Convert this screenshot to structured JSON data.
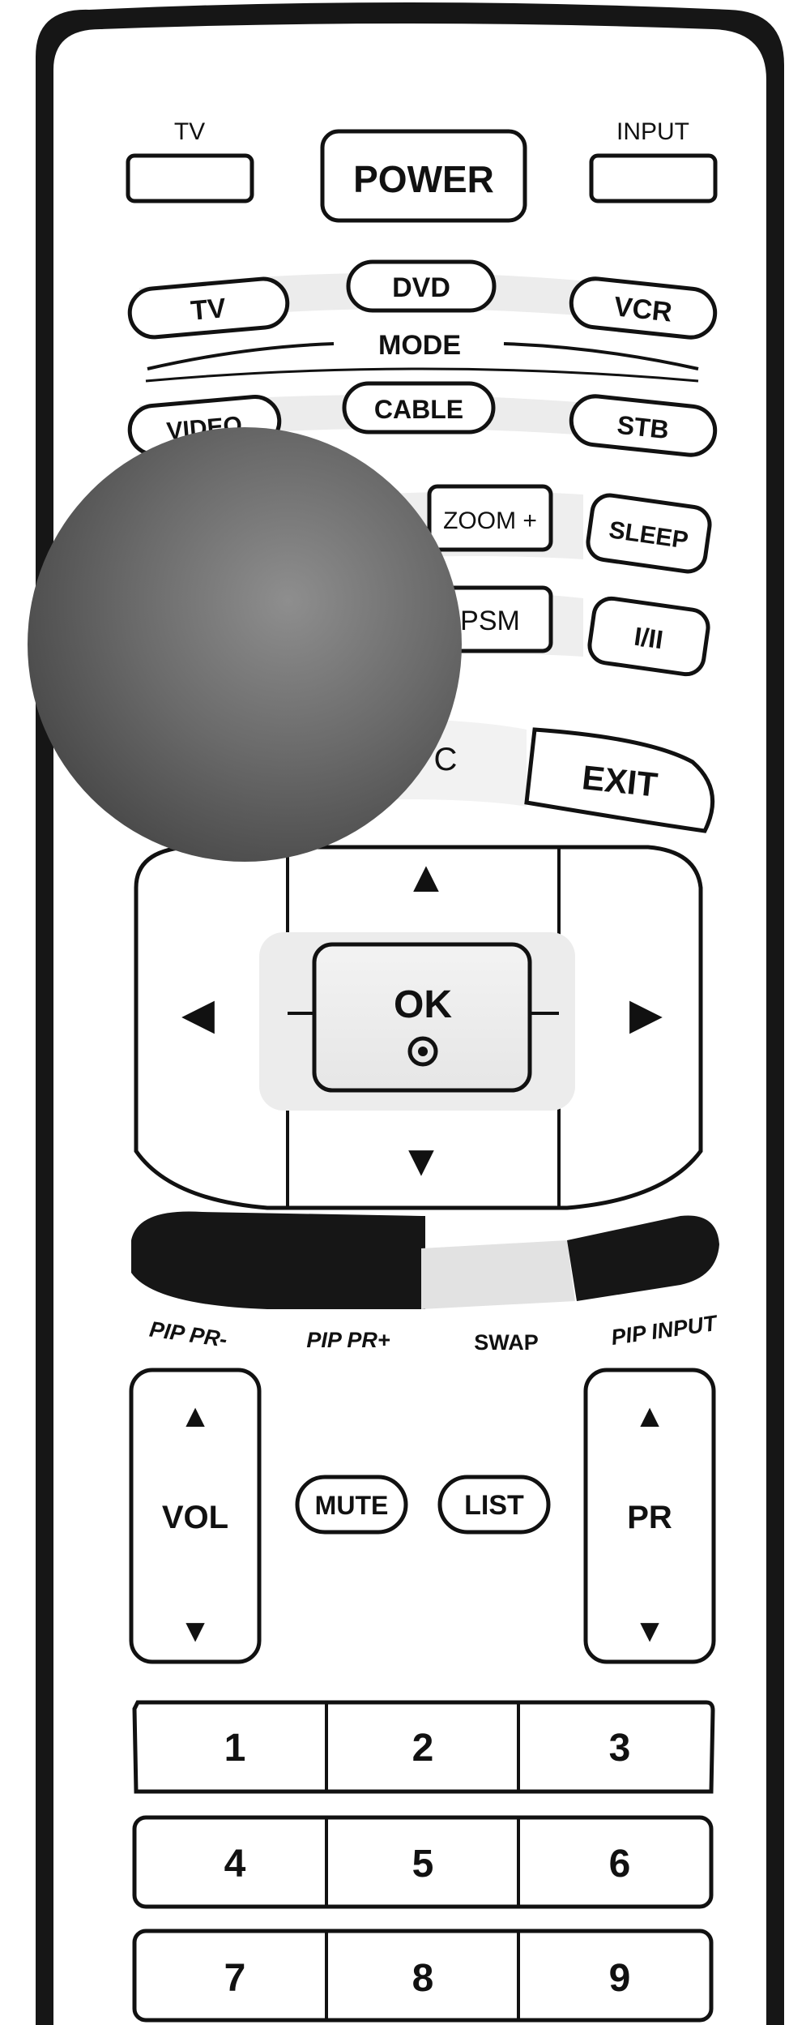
{
  "top": {
    "tv": "TV",
    "power": "POWER",
    "input": "INPUT"
  },
  "mode": {
    "label": "MODE",
    "row1": [
      "TV",
      "DVD",
      "VCR"
    ],
    "row2": [
      "VIDEO",
      "CABLE",
      "STB"
    ]
  },
  "row_zoom": {
    "zoom_plus": "ZOOM +",
    "sleep": "SLEEP"
  },
  "row_psm": {
    "psm": "PSM",
    "i_ii": "I/II"
  },
  "row_exit": {
    "partial": "C",
    "exit": "EXIT"
  },
  "nav": {
    "ok": "OK",
    "up": "▲",
    "down": "▼",
    "left": "◀",
    "right": "▶"
  },
  "pip": {
    "pr_minus": "PIP PR-",
    "pr_plus": "PIP PR+",
    "swap": "SWAP",
    "input": "PIP INPUT"
  },
  "volume": {
    "label": "VOL",
    "up": "▲",
    "down": "▼"
  },
  "program": {
    "label": "PR",
    "up": "▲",
    "down": "▼"
  },
  "mute": "MUTE",
  "list": "LIST",
  "keypad": [
    "1",
    "2",
    "3",
    "4",
    "5",
    "6",
    "7",
    "8",
    "9"
  ],
  "colors": {
    "body": "#1a1a1a",
    "face": "#ffffff",
    "swap_key": "#e2e2e2",
    "shade": "#ececec"
  }
}
